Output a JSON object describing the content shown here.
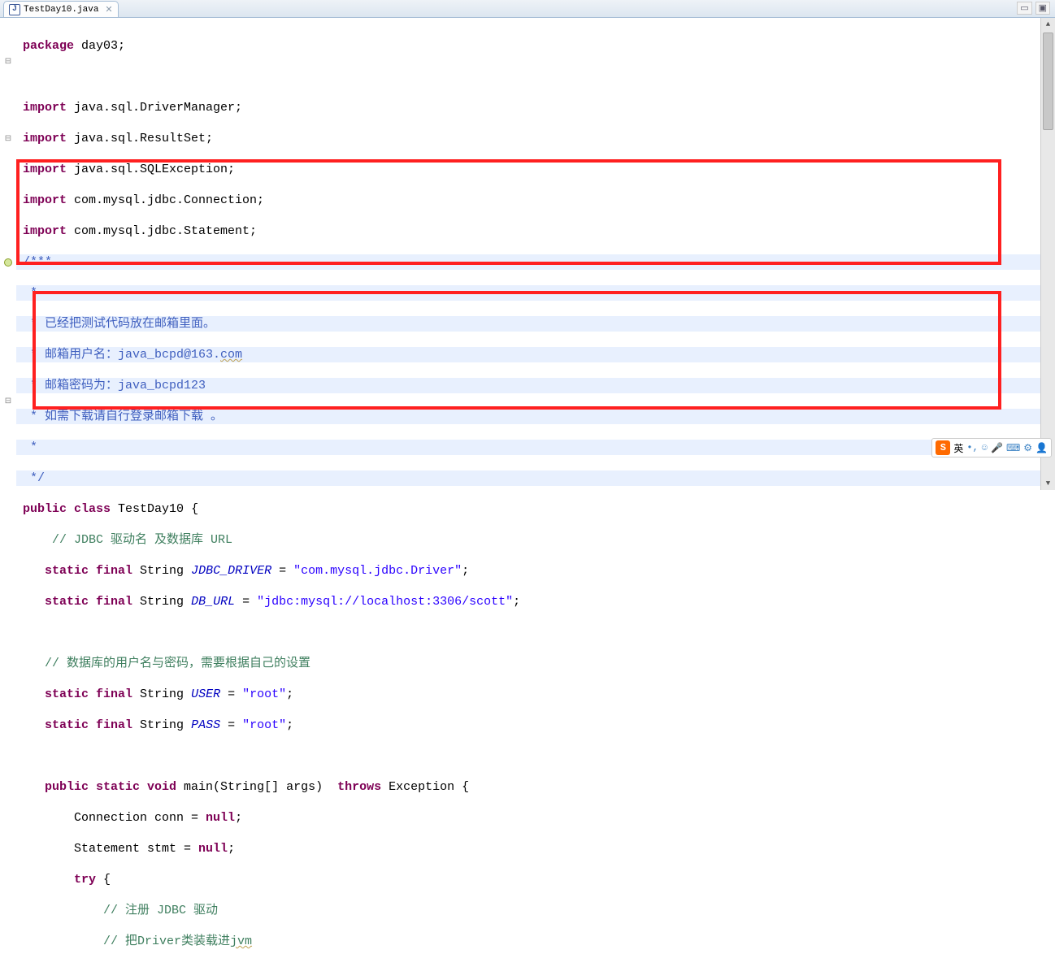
{
  "tab": {
    "title": "TestDay10.java"
  },
  "code": {
    "l1_kw": "package",
    "l1_rest": " day03;",
    "l2_kw": "import",
    "l2_rest": " java.sql.DriverManager;",
    "l3_kw": "import",
    "l3_rest": " java.sql.ResultSet;",
    "l4_kw": "import",
    "l4_rest": " java.sql.SQLException;",
    "l5_kw": "import",
    "l5_rest": " com.mysql.jdbc.Connection;",
    "l6_kw": "import",
    "l6_rest": " com.mysql.jdbc.Statement;",
    "jd_open": "/***",
    "jd_star": " *",
    "jd_l1": " * 已经把测试代码放在邮箱里面。",
    "jd_l2a": " * 邮箱用户名：java_bcpd@163.",
    "jd_l2b": "com",
    "jd_l3": " * 邮箱密码为：java_bcpd123",
    "jd_l4": " * 如需下载请自行登录邮箱下载 。",
    "jd_close": " */",
    "cls_kw1": "public",
    "cls_kw2": "class",
    "cls_name": " TestDay10 {",
    "cmt_jdbc": "    // JDBC 驱动名 及数据库 URL",
    "f1_pre": "   ",
    "f1_kw": "static final",
    "f1_type": " String ",
    "f1_name": "JDBC_DRIVER",
    "f1_eq": " = ",
    "f1_str": "\"com.mysql.jdbc.Driver\"",
    "f1_semi": ";",
    "f2_pre": "   ",
    "f2_kw": "static final",
    "f2_type": " String ",
    "f2_name": "DB_URL",
    "f2_eq": " = ",
    "f2_str": "\"jdbc:mysql://localhost:3306/scott\"",
    "f2_semi": ";",
    "cmt_user": "   // 数据库的用户名与密码，需要根据自己的设置",
    "f3_pre": "   ",
    "f3_kw": "static final",
    "f3_type": " String ",
    "f3_name": "USER",
    "f3_eq": " = ",
    "f3_str": "\"root\"",
    "f3_semi": ";",
    "f4_pre": "   ",
    "f4_kw": "static final",
    "f4_type": " String ",
    "f4_name": "PASS",
    "f4_eq": " = ",
    "f4_str": "\"root\"",
    "f4_semi": ";",
    "m_pre": "   ",
    "m_kw1": "public static void",
    "m_name": " main(String[] args)  ",
    "m_kw2": "throws",
    "m_rest": " Exception {",
    "b1": "       Connection conn = ",
    "b1_kw": "null",
    "b1_semi": ";",
    "b2": "       Statement stmt = ",
    "b2_kw": "null",
    "b2_semi": ";",
    "b3_pre": "       ",
    "b3_kw": "try",
    "b3_rest": " {",
    "cmt_reg": "           // 注册 JDBC 驱动",
    "cmt_drv_a": "           // 把Driver类装载进",
    "cmt_drv_b": "jvm"
  },
  "ime": {
    "lang": "英",
    "sep": "•,"
  }
}
